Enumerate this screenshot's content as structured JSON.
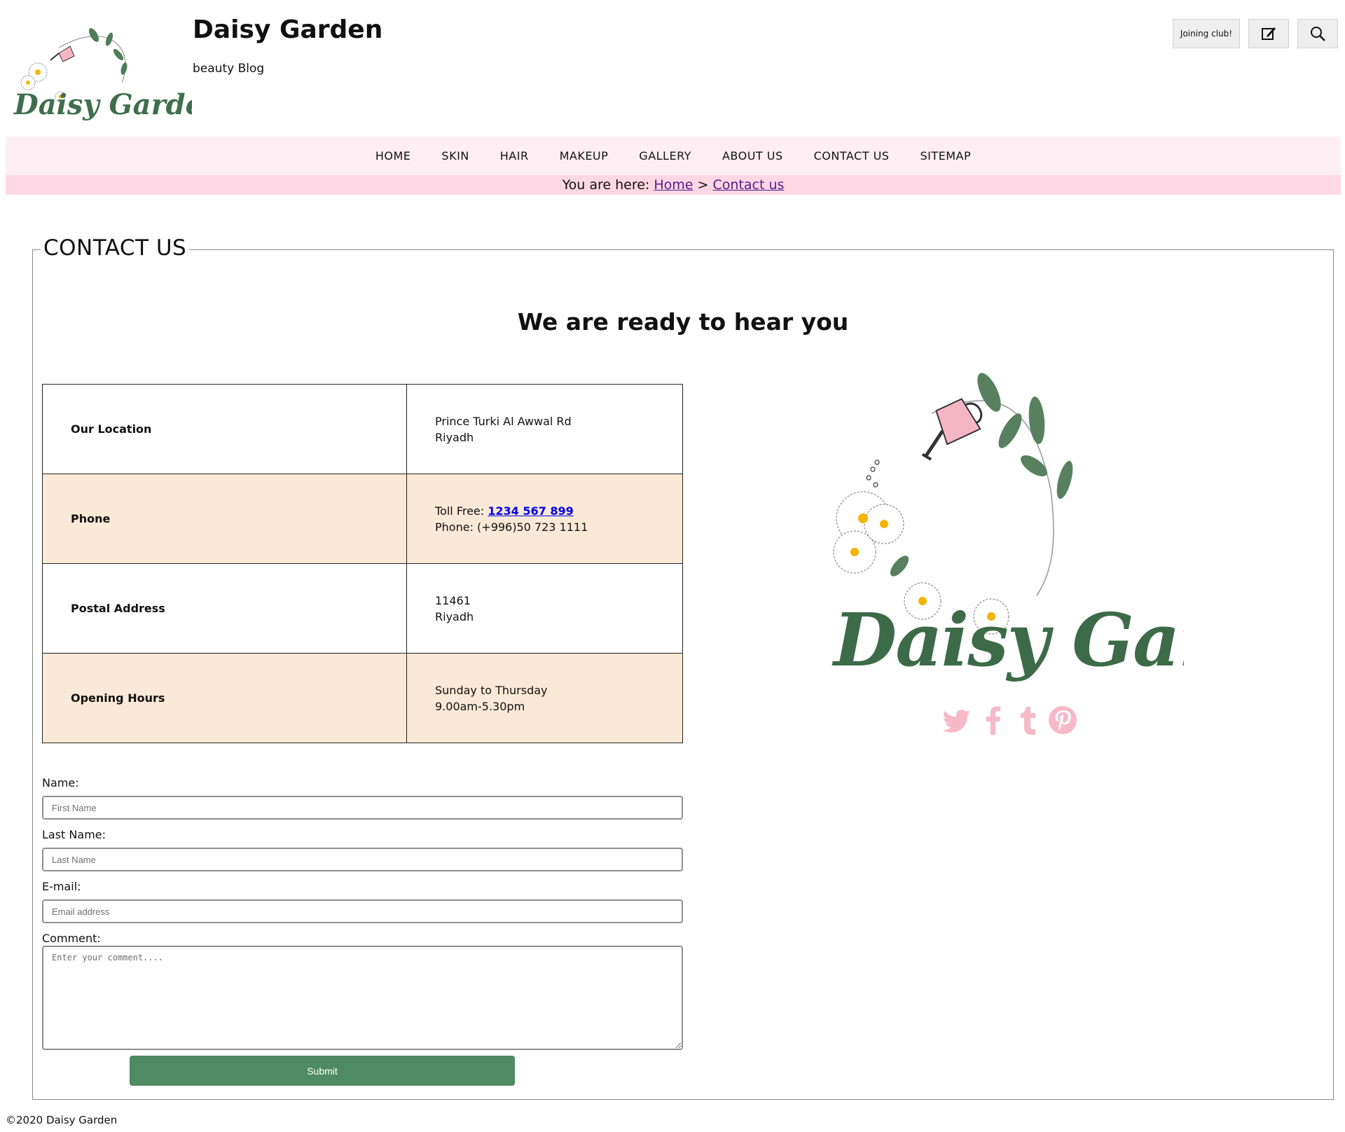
{
  "header": {
    "title": "Daisy Garden",
    "tagline": "beauty Blog",
    "join_label": "Joining club!",
    "edit_icon": "edit-icon",
    "search_icon": "search-icon"
  },
  "nav": {
    "items": [
      "HOME",
      "SKIN",
      "HAIR",
      "MAKEUP",
      "GALLERY",
      "ABOUT US",
      "CONTACT US",
      "SITEMAP"
    ]
  },
  "breadcrumb": {
    "prefix": "You are here:",
    "home": "Home",
    "separator": ">",
    "current": "Contact us"
  },
  "contact": {
    "legend": "CONTACT US",
    "heading": "We are ready to hear you",
    "rows": [
      {
        "key": "Our Location",
        "line1": "Prince Turki Al Awwal Rd",
        "line2": "Riyadh"
      },
      {
        "key": "Phone",
        "toll_label": "Toll Free:",
        "toll_number": "1234 567 899",
        "line2": "Phone: (+996)50 723 1111"
      },
      {
        "key": "Postal Address",
        "line1": "11461",
        "line2": "Riyadh"
      },
      {
        "key": "Opening Hours",
        "line1": "Sunday to Thursday",
        "line2": "9.00am-5.30pm"
      }
    ]
  },
  "form": {
    "name_label": "Name:",
    "name_placeholder": "First Name",
    "lastname_label": "Last Name:",
    "lastname_placeholder": "Last Name",
    "email_label": "E-mail:",
    "email_placeholder": "Email address",
    "comment_label": "Comment:",
    "comment_placeholder": "Enter your comment....",
    "submit_label": "Submit"
  },
  "logo_text": "Daisy Garden",
  "social": [
    "twitter-icon",
    "facebook-icon",
    "tumblr-icon",
    "pinterest-icon"
  ],
  "footer": {
    "copyright": "©2020 Daisy Garden"
  },
  "colors": {
    "nav_bg": "#fdeef3",
    "breadcrumb_bg": "#fdd7e4",
    "row_alt_bg": "#fae9d6",
    "submit_bg": "#4e8a63",
    "social_pink": "#f7b8c8",
    "leaf_green": "#3f6e4c"
  }
}
